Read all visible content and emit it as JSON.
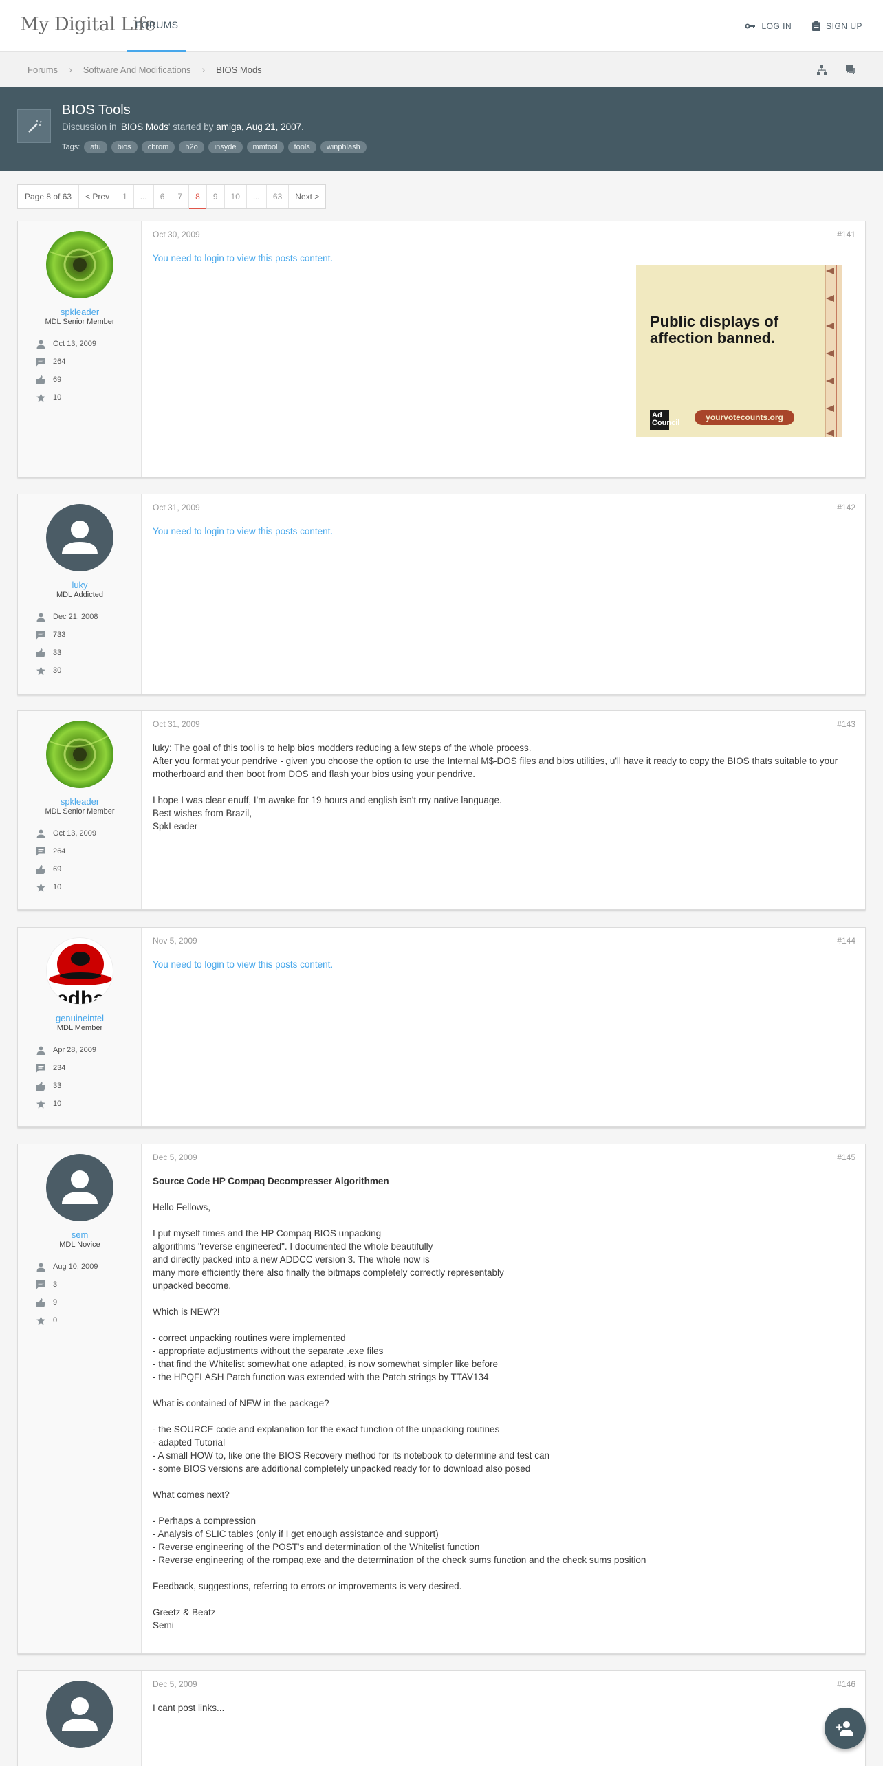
{
  "header": {
    "logo": "My Digital Life",
    "nav_forums": "FORUMS",
    "login": "LOG IN",
    "signup": "SIGN UP"
  },
  "breadcrumb": [
    "Forums",
    "Software And Modifications",
    "BIOS Mods"
  ],
  "thread": {
    "title": "BIOS Tools",
    "meta_prefix": "Discussion in '",
    "forum": "BIOS Mods",
    "meta_mid": "' started by ",
    "author": "amiga",
    "date": ", Aug 21, 2007",
    "tags_label": "Tags:",
    "tags": [
      "afu",
      "bios",
      "cbrom",
      "h2o",
      "insyde",
      "mmtool",
      "tools",
      "winphlash"
    ]
  },
  "pagination": {
    "label": "Page 8 of 63",
    "prev": "< Prev",
    "pages": [
      "1",
      "...",
      "6",
      "7",
      "8",
      "9",
      "10",
      "...",
      "63"
    ],
    "current": "8",
    "next": "Next >"
  },
  "login_message": "You need to login to view this posts content.",
  "ad": {
    "text": "Public displays of affection banned.",
    "cta": "yourvotecounts.org",
    "badge": "Ad Council"
  },
  "posts": [
    {
      "number": "#141",
      "date": "Oct 30, 2009",
      "user": {
        "name": "spkleader",
        "title": "MDL Senior Member",
        "joined": "Oct 13, 2009",
        "messages": "264",
        "likes": "69",
        "points": "10"
      }
    },
    {
      "number": "#142",
      "date": "Oct 31, 2009",
      "user": {
        "name": "luky",
        "title": "MDL Addicted",
        "joined": "Dec 21, 2008",
        "messages": "733",
        "likes": "33",
        "points": "30"
      }
    },
    {
      "number": "#143",
      "date": "Oct 31, 2009",
      "user": {
        "name": "spkleader",
        "title": "MDL Senior Member",
        "joined": "Oct 13, 2009",
        "messages": "264",
        "likes": "69",
        "points": "10"
      },
      "lines": [
        "luky: The goal of this tool is to help bios modders reducing a few steps of the whole process.",
        "After you format your pendrive - given you choose the option to use the Internal M$-DOS files and bios utilities, u'll have it ready to copy the BIOS thats suitable to your motherboard and then boot from DOS and flash your bios using your pendrive.",
        "",
        "I hope I was clear enuff, I'm awake for 19 hours and english isn't my native language.",
        "Best wishes from Brazil,",
        "SpkLeader"
      ]
    },
    {
      "number": "#144",
      "date": "Nov 5, 2009",
      "user": {
        "name": "genuineintel",
        "title": "MDL Member",
        "joined": "Apr 28, 2009",
        "messages": "234",
        "likes": "33",
        "points": "10"
      }
    },
    {
      "number": "#145",
      "date": "Dec 5, 2009",
      "user": {
        "name": "sem",
        "title": "MDL Novice",
        "joined": "Aug 10, 2009",
        "messages": "3",
        "likes": "9",
        "points": "0"
      },
      "heading": "Source Code HP Compaq Decompresser Algorithmen",
      "lines": [
        "",
        "Hello Fellows,",
        "",
        "I put myself times and the HP Compaq BIOS unpacking",
        "algorithms \"reverse engineered\". I documented the whole beautifully",
        "and directly packed into a new ADDCC version 3. The whole now is",
        "many more efficiently there also finally the bitmaps completely correctly representably",
        "unpacked become.",
        "",
        "Which is NEW?!",
        "",
        "- correct unpacking routines were implemented",
        "- appropriate adjustments without the separate .exe files",
        "- that find the Whitelist somewhat one adapted, is now somewhat simpler like before",
        "- the HPQFLASH Patch function was extended with the Patch strings by TTAV134",
        "",
        "What is contained of NEW in the package?",
        "",
        "- the SOURCE code and explanation for the exact function of the unpacking routines",
        "- adapted Tutorial",
        "- A small HOW to, like one the BIOS Recovery method for its notebook to determine and test can",
        "- some BIOS versions are additional completely unpacked ready for to download also posed",
        "",
        "What comes next?",
        "",
        "- Perhaps a compression",
        "- Analysis of SLIC tables (only if I get enough assistance and support)",
        "- Reverse engineering of the POST's and determination of the Whitelist function",
        "- Reverse engineering of the rompaq.exe and the determination of the check sums function and the check sums position",
        "",
        "Feedback, suggestions, referring to errors or improvements is very desired.",
        "",
        "Greetz & Beatz",
        "Semi"
      ]
    },
    {
      "number": "#146",
      "date": "Dec 5, 2009",
      "lines": [
        "I cant post links..."
      ]
    }
  ]
}
